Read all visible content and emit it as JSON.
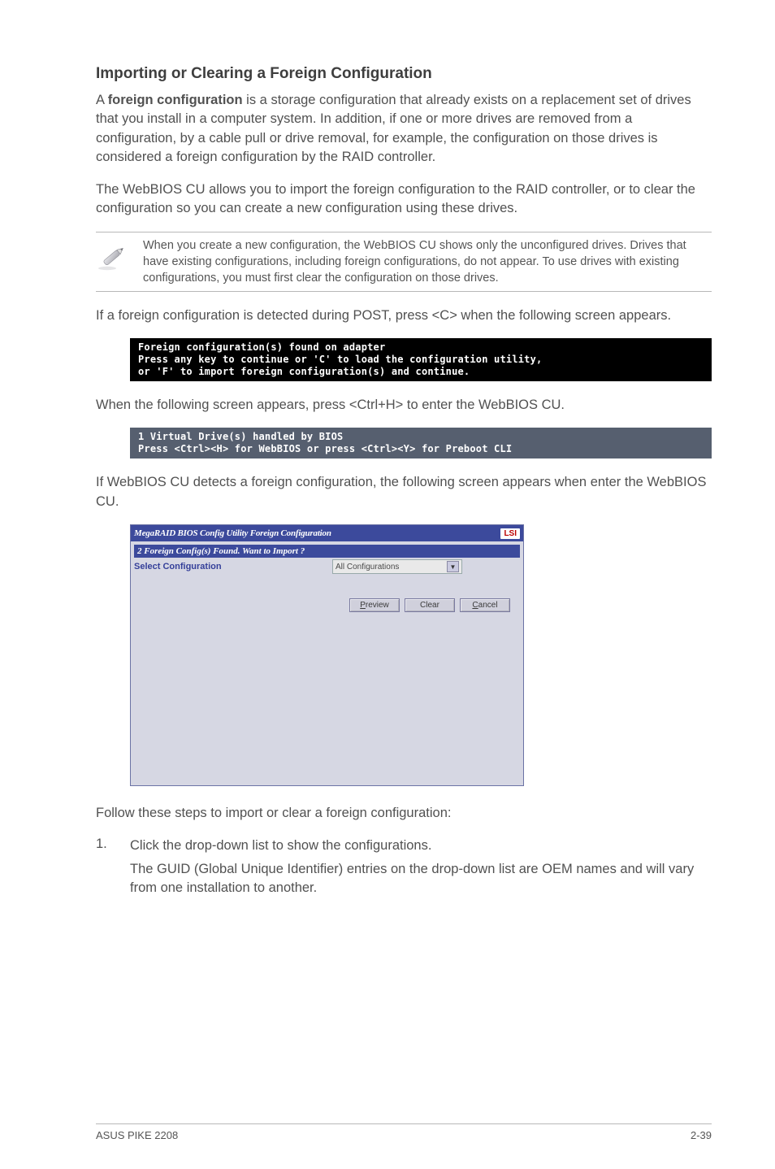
{
  "heading": "Importing or Clearing a Foreign Configuration",
  "para1_prefix": "A ",
  "para1_bold": "foreign configuration",
  "para1_rest": " is a storage configuration that already exists on a replacement set of drives that you install in a computer system. In addition, if one or more drives are removed from a configuration, by a cable pull or drive removal, for example, the configuration on those drives is considered a foreign configuration by the RAID controller.",
  "para2": "The WebBIOS CU allows you to import the foreign configuration to the RAID controller, or to clear the configuration so you can create a new configuration using these drives.",
  "note1": "When you create a new configuration, the WebBIOS CU shows only the unconfigured drives. Drives that have existing configurations, including foreign configurations, do not appear. To use drives with existing configurations, you must first clear the configuration on those drives.",
  "para3": "If a foreign configuration is detected during POST, press <C> when the following screen appears.",
  "terminal_black": "Foreign configuration(s) found on adapter\nPress any key to continue or 'C' to load the configuration utility,\nor 'F' to import foreign configuration(s) and continue.",
  "para4": "When the following screen appears, press <Ctrl+H> to enter the WebBIOS CU.",
  "terminal_grey": "1 Virtual Drive(s) handled by BIOS\nPress <Ctrl><H> for WebBIOS or press <Ctrl><Y> for Preboot CLI",
  "para5": "If WebBIOS CU detects a foreign configuration, the following screen appears when enter the WebBIOS CU.",
  "dialog": {
    "title": "MegaRAID BIOS Config Utility Foreign Configuration",
    "logo": "LSI",
    "found_bar": "2  Foreign Config(s) Found. Want to Import ?",
    "label": "Select Configuration",
    "select_value": "All Configurations",
    "buttons": {
      "preview": "Preview",
      "clear": "Clear",
      "cancel": "Cancel"
    }
  },
  "para6": "Follow these steps to import or clear a foreign configuration:",
  "steps": {
    "num1": "1.",
    "s1a": "Click the drop-down list to show the configurations.",
    "s1b": "The GUID (Global Unique Identifier) entries on the drop-down list are OEM names and will vary from one installation to another."
  },
  "footer": {
    "left": "ASUS PIKE 2208",
    "right": "2-39"
  }
}
